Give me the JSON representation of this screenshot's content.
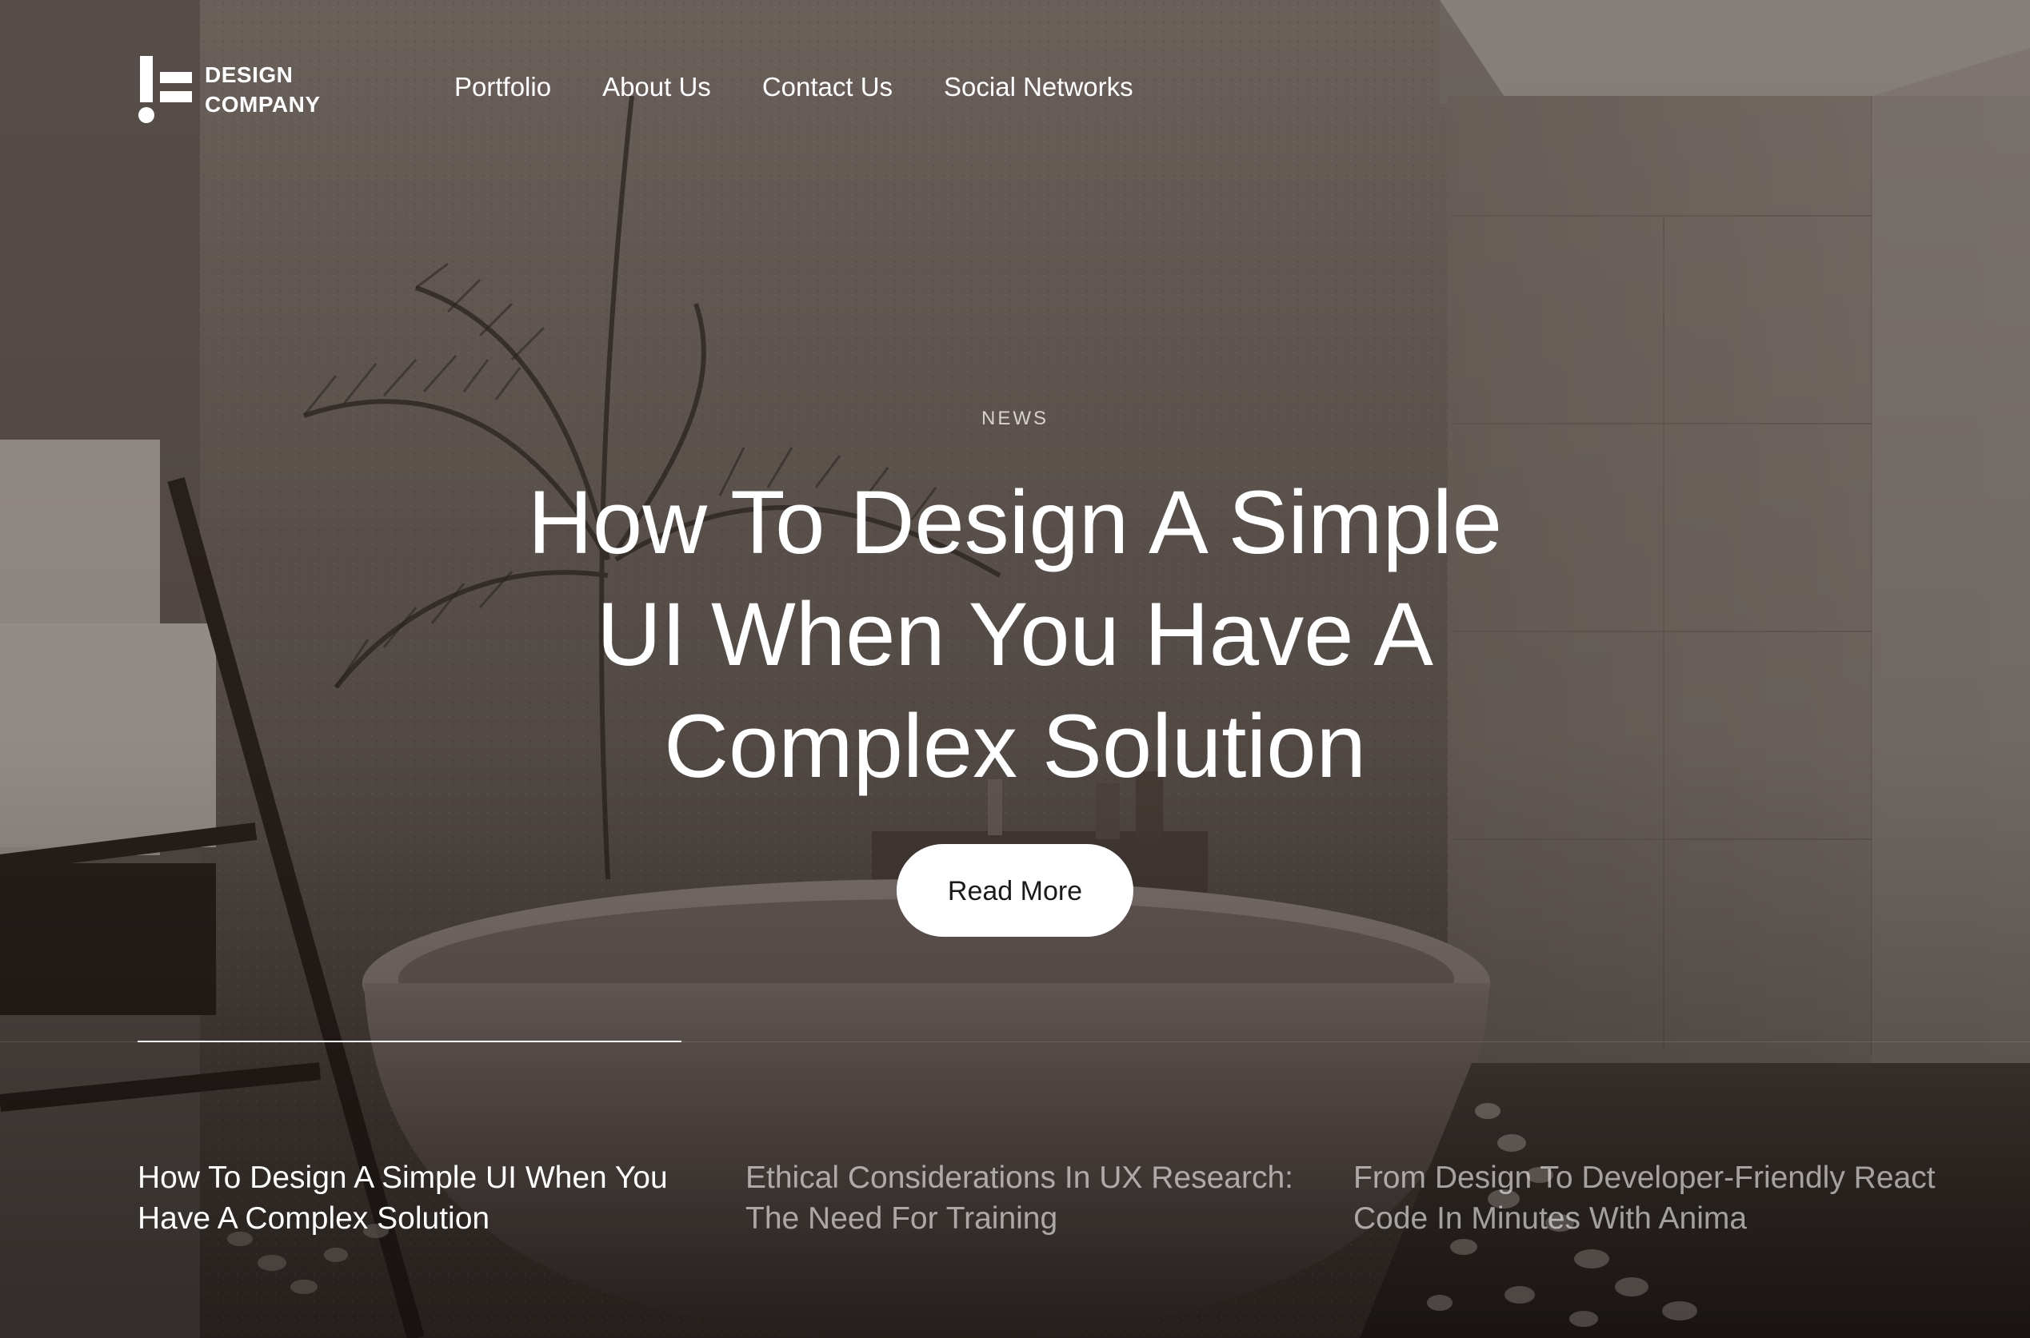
{
  "brand": {
    "line1": "DESIGN",
    "line2": "COMPANY",
    "icon": "exclamation-bars-logo"
  },
  "nav": {
    "items": [
      {
        "label": "Portfolio"
      },
      {
        "label": "About Us"
      },
      {
        "label": "Contact Us"
      },
      {
        "label": "Social Networks"
      }
    ]
  },
  "hero": {
    "kicker": "NEWS",
    "headline": "How To Design A Simple UI When You Have A Complex Solution",
    "cta_label": "Read More"
  },
  "articles": [
    {
      "title": "How To Design A Simple UI When You Have A Complex Solution",
      "active": true
    },
    {
      "title": "Ethical Considerations In UX Research: The Need For Training",
      "active": false
    },
    {
      "title": "From Design To Developer-Friendly React Code In Minutes With Anima",
      "active": false
    }
  ],
  "colors": {
    "text": "#ffffff",
    "button_bg": "#ffffff",
    "button_text": "#1a1a1a",
    "overlay_tint": "#3a302b"
  }
}
